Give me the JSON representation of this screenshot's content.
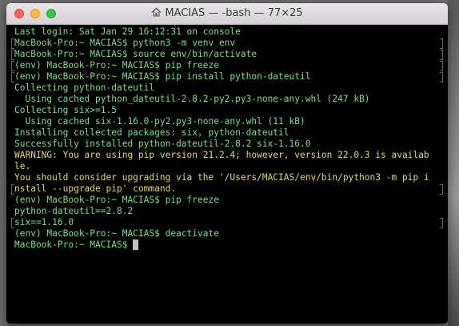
{
  "window": {
    "title": "MACIAS — -bash — 77×25",
    "icon": "home-icon"
  },
  "colors": {
    "terminal_background": "#000000",
    "terminal_text": "#71e07a",
    "warning_text": "#e2d85e",
    "cursor": "#bfbfbf"
  },
  "terminal": {
    "lines": [
      {
        "text": "Last login: Sat Jan 29 16:12:31 on console",
        "style": "normal"
      },
      {
        "text": "MacBook-Pro:~ MACIAS$ python3 -m venv env",
        "style": "normal"
      },
      {
        "text": "MacBook-Pro:~ MACIAS$ source env/bin/activate",
        "style": "normal"
      },
      {
        "text": "(env) MacBook-Pro:~ MACIAS$ pip freeze",
        "style": "normal"
      },
      {
        "text": "(env) MacBook-Pro:~ MACIAS$ pip install python-dateutil",
        "style": "normal"
      },
      {
        "text": "Collecting python-dateutil",
        "style": "normal"
      },
      {
        "text": "  Using cached python_dateutil-2.8.2-py2.py3-none-any.whl (247 kB)",
        "style": "normal"
      },
      {
        "text": "Collecting six>=1.5",
        "style": "normal"
      },
      {
        "text": "  Using cached six-1.16.0-py2.py3-none-any.whl (11 kB)",
        "style": "normal"
      },
      {
        "text": "Installing collected packages: six, python-dateutil",
        "style": "normal"
      },
      {
        "text": "Successfully installed python-dateutil-2.8.2 six-1.16.0",
        "style": "normal"
      },
      {
        "text": "WARNING: You are using pip version 21.2.4; however, version 22.0.3 is availab",
        "style": "warning"
      },
      {
        "text": "le.",
        "style": "warning"
      },
      {
        "text": "You should consider upgrading via the '/Users/MACIAS/env/bin/python3 -m pip i",
        "style": "warning"
      },
      {
        "text": "nstall --upgrade pip' command.",
        "style": "warning"
      },
      {
        "text": "(env) MacBook-Pro:~ MACIAS$ pip freeze",
        "style": "normal"
      },
      {
        "text": "python-dateutil==2.8.2",
        "style": "normal"
      },
      {
        "text": "six==1.16.0",
        "style": "normal"
      },
      {
        "text": "(env) MacBook-Pro:~ MACIAS$ deactivate",
        "style": "normal"
      },
      {
        "text": "MacBook-Pro:~ MACIAS$ ",
        "style": "normal"
      }
    ]
  }
}
